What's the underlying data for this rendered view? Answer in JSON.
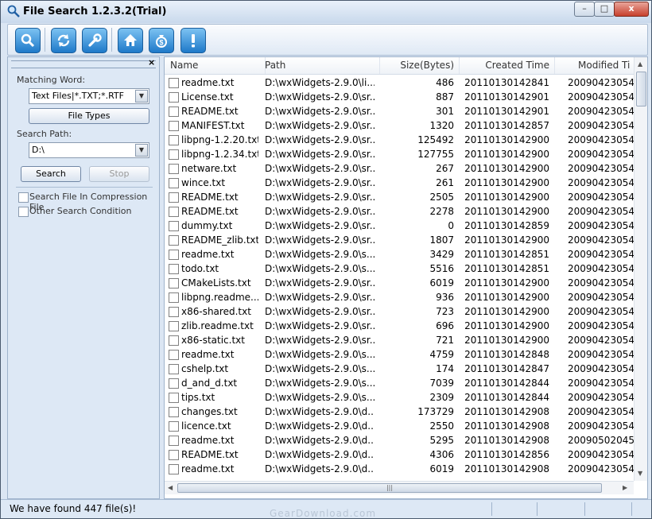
{
  "window": {
    "title": "File Search 1.2.3.2(Trial)"
  },
  "title_buttons": {
    "minimize": "–",
    "maximize": "□",
    "close": "x"
  },
  "toolbar": {
    "buttons": [
      "search-icon",
      "refresh-icon",
      "wrench-icon",
      "home-icon",
      "money-bag-icon",
      "info-icon"
    ]
  },
  "left_panel": {
    "close_glyph": "×",
    "matching_word_label": "Matching Word:",
    "matching_word_value": "Text Files|*.TXT;*.RTF",
    "file_types_button": "File Types",
    "search_path_label": "Search Path:",
    "search_path_value": "D:\\",
    "search_button": "Search",
    "stop_button": "Stop",
    "checkbox_compression": "Search File In Compression File",
    "checkbox_other": "Other Search Condition"
  },
  "list": {
    "columns": [
      "Name",
      "Path",
      "Size(Bytes)",
      "Created Time",
      "Modified Ti"
    ],
    "rows": [
      {
        "name": "readme.txt",
        "path": "D:\\wxWidgets-2.9.0\\li...",
        "size": "486",
        "created": "20110130142841",
        "modified": "20090423054"
      },
      {
        "name": "License.txt",
        "path": "D:\\wxWidgets-2.9.0\\sr...",
        "size": "887",
        "created": "20110130142901",
        "modified": "20090423054"
      },
      {
        "name": "README.txt",
        "path": "D:\\wxWidgets-2.9.0\\sr...",
        "size": "301",
        "created": "20110130142901",
        "modified": "20090423054"
      },
      {
        "name": "MANIFEST.txt",
        "path": "D:\\wxWidgets-2.9.0\\sr...",
        "size": "1320",
        "created": "20110130142857",
        "modified": "20090423054"
      },
      {
        "name": "libpng-1.2.20.txt",
        "path": "D:\\wxWidgets-2.9.0\\sr...",
        "size": "125492",
        "created": "20110130142900",
        "modified": "20090423054"
      },
      {
        "name": "libpng-1.2.34.txt",
        "path": "D:\\wxWidgets-2.9.0\\sr...",
        "size": "127755",
        "created": "20110130142900",
        "modified": "20090423054"
      },
      {
        "name": "netware.txt",
        "path": "D:\\wxWidgets-2.9.0\\sr...",
        "size": "267",
        "created": "20110130142900",
        "modified": "20090423054"
      },
      {
        "name": "wince.txt",
        "path": "D:\\wxWidgets-2.9.0\\sr...",
        "size": "261",
        "created": "20110130142900",
        "modified": "20090423054"
      },
      {
        "name": "README.txt",
        "path": "D:\\wxWidgets-2.9.0\\sr...",
        "size": "2505",
        "created": "20110130142900",
        "modified": "20090423054"
      },
      {
        "name": "README.txt",
        "path": "D:\\wxWidgets-2.9.0\\sr...",
        "size": "2278",
        "created": "20110130142900",
        "modified": "20090423054"
      },
      {
        "name": "dummy.txt",
        "path": "D:\\wxWidgets-2.9.0\\sr...",
        "size": "0",
        "created": "20110130142859",
        "modified": "20090423054"
      },
      {
        "name": "README_zlib.txt",
        "path": "D:\\wxWidgets-2.9.0\\sr...",
        "size": "1807",
        "created": "20110130142900",
        "modified": "20090423054"
      },
      {
        "name": "readme.txt",
        "path": "D:\\wxWidgets-2.9.0\\s...",
        "size": "3429",
        "created": "20110130142851",
        "modified": "20090423054"
      },
      {
        "name": "todo.txt",
        "path": "D:\\wxWidgets-2.9.0\\s...",
        "size": "5516",
        "created": "20110130142851",
        "modified": "20090423054"
      },
      {
        "name": "CMakeLists.txt",
        "path": "D:\\wxWidgets-2.9.0\\sr...",
        "size": "6019",
        "created": "20110130142900",
        "modified": "20090423054"
      },
      {
        "name": "libpng.readme....",
        "path": "D:\\wxWidgets-2.9.0\\sr...",
        "size": "936",
        "created": "20110130142900",
        "modified": "20090423054"
      },
      {
        "name": "x86-shared.txt",
        "path": "D:\\wxWidgets-2.9.0\\sr...",
        "size": "723",
        "created": "20110130142900",
        "modified": "20090423054"
      },
      {
        "name": "zlib.readme.txt",
        "path": "D:\\wxWidgets-2.9.0\\sr...",
        "size": "696",
        "created": "20110130142900",
        "modified": "20090423054"
      },
      {
        "name": "x86-static.txt",
        "path": "D:\\wxWidgets-2.9.0\\sr...",
        "size": "721",
        "created": "20110130142900",
        "modified": "20090423054"
      },
      {
        "name": "readme.txt",
        "path": "D:\\wxWidgets-2.9.0\\s...",
        "size": "4759",
        "created": "20110130142848",
        "modified": "20090423054"
      },
      {
        "name": "cshelp.txt",
        "path": "D:\\wxWidgets-2.9.0\\s...",
        "size": "174",
        "created": "20110130142847",
        "modified": "20090423054"
      },
      {
        "name": "d_and_d.txt",
        "path": "D:\\wxWidgets-2.9.0\\s...",
        "size": "7039",
        "created": "20110130142844",
        "modified": "20090423054"
      },
      {
        "name": "tips.txt",
        "path": "D:\\wxWidgets-2.9.0\\s...",
        "size": "2309",
        "created": "20110130142844",
        "modified": "20090423054"
      },
      {
        "name": "changes.txt",
        "path": "D:\\wxWidgets-2.9.0\\d...",
        "size": "173729",
        "created": "20110130142908",
        "modified": "20090423054"
      },
      {
        "name": "licence.txt",
        "path": "D:\\wxWidgets-2.9.0\\d...",
        "size": "2550",
        "created": "20110130142908",
        "modified": "20090423054"
      },
      {
        "name": "readme.txt",
        "path": "D:\\wxWidgets-2.9.0\\d...",
        "size": "5295",
        "created": "20110130142908",
        "modified": "20090502045"
      },
      {
        "name": "README.txt",
        "path": "D:\\wxWidgets-2.9.0\\d...",
        "size": "4306",
        "created": "20110130142856",
        "modified": "20090423054"
      },
      {
        "name": "readme.txt",
        "path": "D:\\wxWidgets-2.9.0\\d...",
        "size": "6019",
        "created": "20110130142908",
        "modified": "20090423054"
      }
    ],
    "hscroll_grip": "|||"
  },
  "status": {
    "text": "We have found 447 file(s)!",
    "watermark": "GearDownload.com"
  }
}
